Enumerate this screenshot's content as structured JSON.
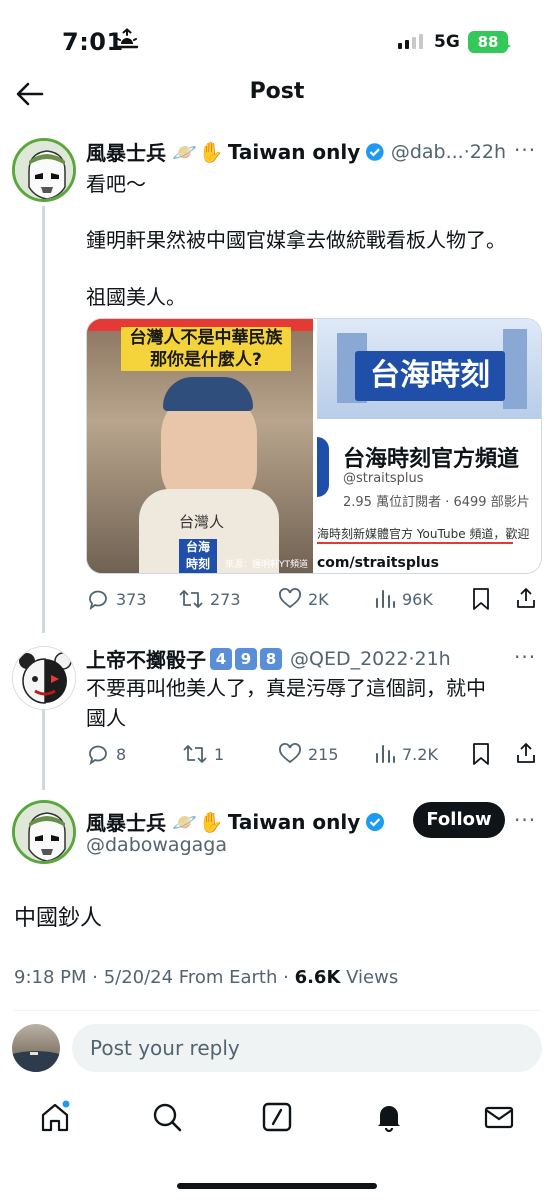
{
  "status_bar": {
    "time": "7:01",
    "network": "5G",
    "battery": "88"
  },
  "header": {
    "title": "Post"
  },
  "tweet1": {
    "name": "風暴士兵",
    "name_suffix": "Taiwan only",
    "handle": "@dab...",
    "time": "·22h",
    "more": "···",
    "lines": [
      "看吧～",
      "鍾明軒果然被中國官媒拿去做統戰看板人物了。",
      "祖國美人。"
    ],
    "media_left": {
      "banner": "台灣人不是中華民族",
      "banner2": "那你是什麼人?",
      "caption": "台灣人",
      "logo1": "台海",
      "logo2": "時刻",
      "credit": "來源：鍾明軒YT頻道"
    },
    "media_right": {
      "logo": "台海時刻",
      "channel": "台海時刻官方頻道",
      "handle": "@straitsplus",
      "stats": "2.95 萬位訂閱者 · 6499 部影片",
      "desc": "海時刻新媒體官方 YouTube 頻道，歡迎",
      "url": "com/straitsplus"
    },
    "stats": {
      "replies": "373",
      "reposts": "273",
      "likes": "2K",
      "views": "96K"
    }
  },
  "tweet2": {
    "name": "上帝不擲骰子",
    "badges": [
      "4",
      "9",
      "8"
    ],
    "handle": "@QED_2022",
    "time": "·21h",
    "more": "···",
    "lines": [
      "不要再叫他美人了，真是污辱了這個詞，就中",
      "國人"
    ],
    "stats": {
      "replies": "8",
      "reposts": "1",
      "likes": "215",
      "views": "7.2K"
    }
  },
  "main_tweet": {
    "name": "風暴士兵",
    "name_suffix": "Taiwan only",
    "handle": "@dabowagaga",
    "follow_label": "Follow",
    "text": "中國鈔人",
    "meta_time": "9:18 PM · 5/20/24 From Earth · ",
    "meta_views_count": "6.6K",
    "meta_views_label": " Views"
  },
  "reply_bar": {
    "placeholder": "Post your reply"
  },
  "colors": {
    "accent": "#1d9bf0",
    "verified": "#1d9bf0",
    "battery": "#34c759"
  }
}
